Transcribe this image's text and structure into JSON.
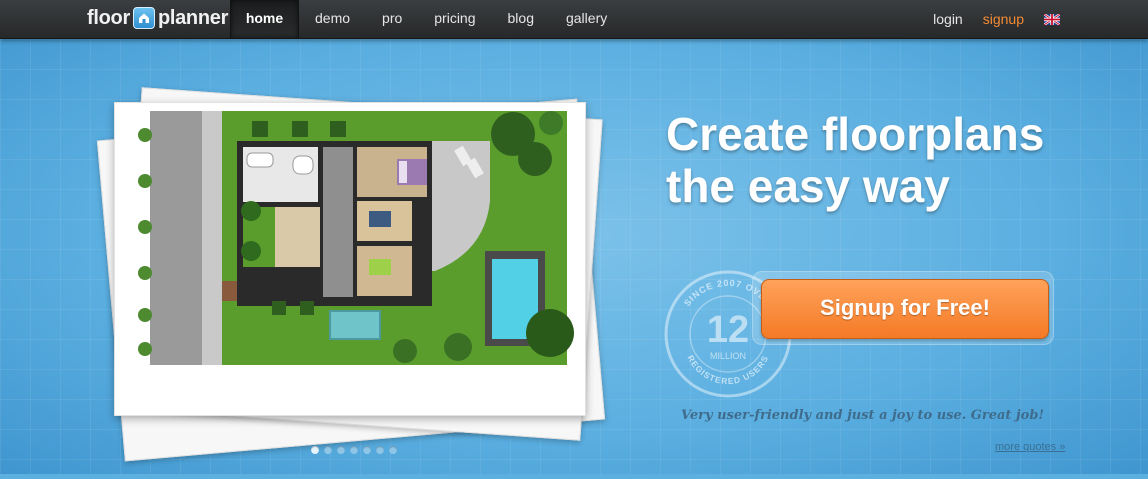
{
  "header": {
    "logo": {
      "part1": "floor",
      "part2": "planner"
    },
    "nav": [
      {
        "label": "home",
        "active": true
      },
      {
        "label": "demo"
      },
      {
        "label": "pro"
      },
      {
        "label": "pricing"
      },
      {
        "label": "blog"
      },
      {
        "label": "gallery"
      }
    ],
    "login_label": "login",
    "signup_label": "signup",
    "language_icon": "uk-flag-icon"
  },
  "hero": {
    "headline_line1": "Create floorplans",
    "headline_line2": "the easy way",
    "badge": {
      "top_text": "SINCE 2007 OVER",
      "number": "12",
      "unit": "MILLION",
      "bottom_text": "REGISTERED USERS"
    },
    "cta_label": "Signup for Free!",
    "quote": "Very user-friendly and just a joy to use. Great job!",
    "more_quotes_label": "more quotes »",
    "slides_total": 7,
    "slide_active": 1
  },
  "colors": {
    "accent_orange": "#f47a26",
    "nav_bg": "#2e3133",
    "hero_blue": "#5cb0e0"
  }
}
